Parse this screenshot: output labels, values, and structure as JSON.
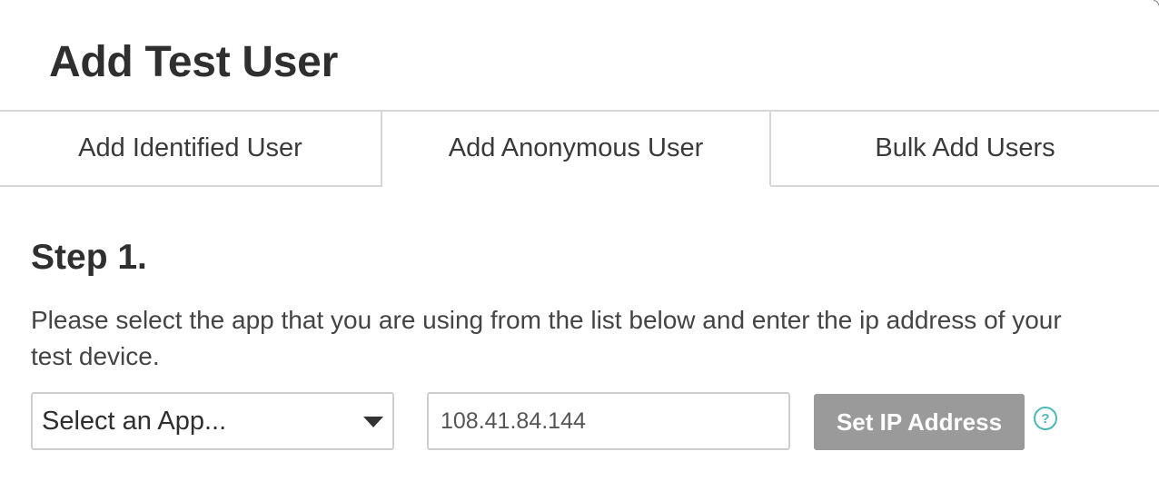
{
  "dialog": {
    "title": "Add Test User"
  },
  "tabs": [
    {
      "label": "Add Identified User",
      "active": false
    },
    {
      "label": "Add Anonymous User",
      "active": true
    },
    {
      "label": "Bulk Add Users",
      "active": false
    }
  ],
  "step": {
    "heading": "Step 1.",
    "description": "Please select the app that you are using from the list below and enter the ip address of your test device."
  },
  "form": {
    "app_select": {
      "selected": "Select an App..."
    },
    "ip_input": {
      "value": "108.41.84.144"
    },
    "set_ip_button": {
      "label": "Set IP Address"
    },
    "help": {
      "glyph": "?",
      "icon": "question-icon"
    }
  },
  "colors": {
    "button_bg": "#9a9a9a",
    "help_accent": "#4bb8b6",
    "border": "#d6d6d6"
  }
}
